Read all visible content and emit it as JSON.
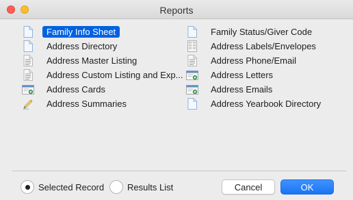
{
  "window": {
    "title": "Reports"
  },
  "colors": {
    "accent": "#0062e1",
    "close": "#fd5f57",
    "minimize": "#febc2e"
  },
  "reports": {
    "left": [
      {
        "label": "Family Info Sheet",
        "icon": "blank-document-icon",
        "selected": true
      },
      {
        "label": "Address Directory",
        "icon": "blank-document-icon",
        "selected": false
      },
      {
        "label": "Address Master Listing",
        "icon": "text-document-icon",
        "selected": false
      },
      {
        "label": "Address Custom Listing and Exp...",
        "icon": "text-document-icon",
        "selected": false
      },
      {
        "label": "Address Cards",
        "icon": "card-export-icon",
        "selected": false
      },
      {
        "label": "Address Summaries",
        "icon": "summary-pencil-icon",
        "selected": false
      }
    ],
    "right": [
      {
        "label": "Family Status/Giver Code",
        "icon": "blank-document-icon",
        "selected": false
      },
      {
        "label": "Address Labels/Envelopes",
        "icon": "labels-grid-icon",
        "selected": false
      },
      {
        "label": "Address Phone/Email",
        "icon": "text-document-icon",
        "selected": false
      },
      {
        "label": "Address Letters",
        "icon": "card-export-icon",
        "selected": false
      },
      {
        "label": "Address Emails",
        "icon": "card-export-icon",
        "selected": false
      },
      {
        "label": "Address Yearbook Directory",
        "icon": "blank-document-icon",
        "selected": false
      }
    ]
  },
  "footer": {
    "selected_record_label": "Selected Record",
    "results_list_label": "Results List",
    "selected_option": "Selected Record",
    "cancel_label": "Cancel",
    "ok_label": "OK"
  }
}
